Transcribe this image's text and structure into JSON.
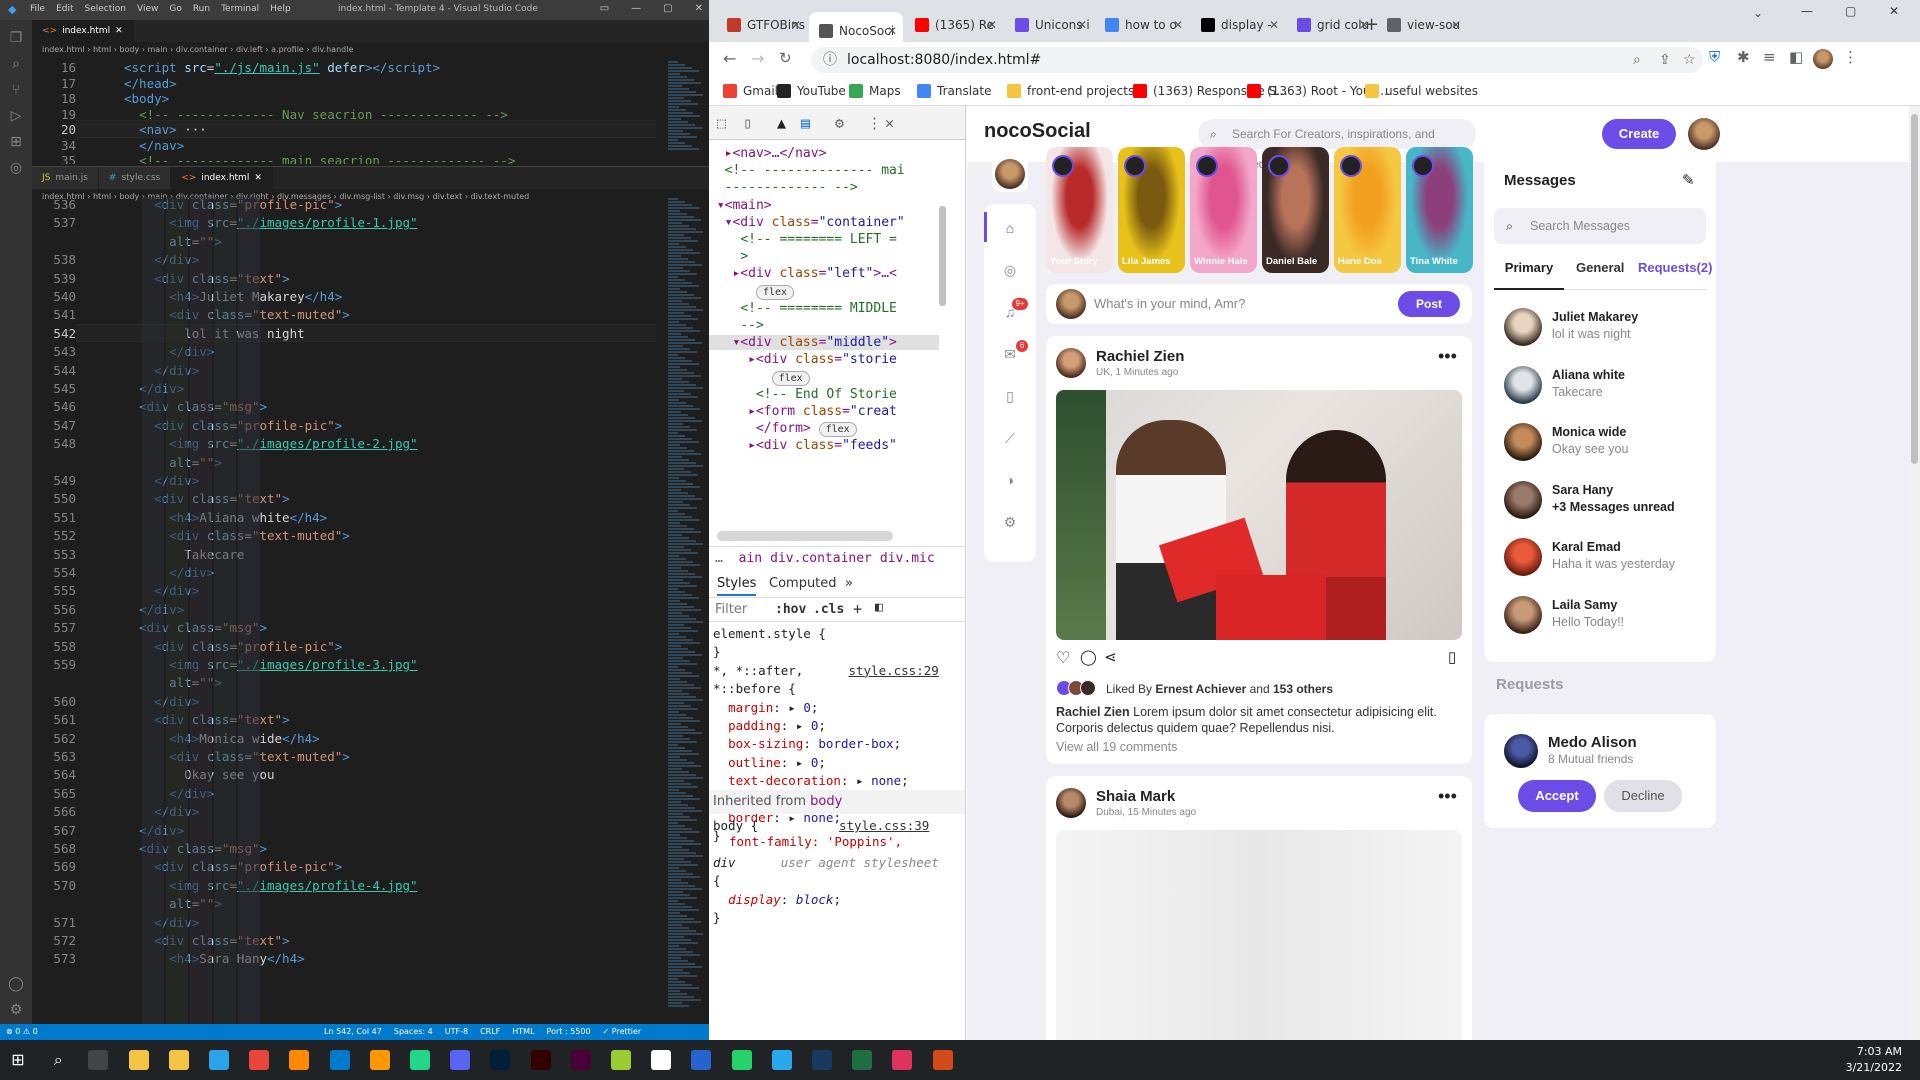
{
  "vscode": {
    "menu": [
      "File",
      "Edit",
      "Selection",
      "View",
      "Go",
      "Run",
      "Terminal",
      "Help"
    ],
    "window_title": "index.html - Template 4 - Visual Studio Code",
    "top_tab": "index.html",
    "top_crumbs": "index.html › html › body › main › div.container › div.left › a.profile › div.handle",
    "top_lines": [
      {
        "n": "16",
        "html": "<span class='t-tag'>&lt;script</span> <span class='t-attr'>src</span>=<span class='t-lnk'>\"./js/main.js\"</span> <span class='t-attr'>defer</span><span class='t-tag'>&gt;&lt;/script&gt;</span>"
      },
      {
        "n": "17",
        "html": "<span class='t-tag'>&lt;/head&gt;</span>"
      },
      {
        "n": "18",
        "html": "<span class='t-tag'>&lt;body&gt;</span>"
      },
      {
        "n": "19",
        "html": "  <span class='t-com'>&lt;!-- ------------- Nav seacrion ------------- --&gt;</span>"
      },
      {
        "n": "20",
        "html": "  <span class='t-tag'>&lt;nav&gt;</span> ···"
      },
      {
        "n": "34",
        "html": "  <span class='t-tag'>&lt;/nav&gt;</span>"
      },
      {
        "n": "35",
        "html": "  <span class='t-com'>&lt;!-- ------------- main seacrion ------------- --&gt;</span>"
      }
    ],
    "bottom_tabs": [
      "main.js",
      "style.css",
      "index.html"
    ],
    "bottom_crumbs": "index.html › html › body › main › div.container › div.right › div.messages › div.msg-list › div.msg › div.text › div.text-muted",
    "bottom_lines": [
      {
        "n": "536",
        "html": "    <span class='t-tag'>&lt;div</span> <span class='t-attr'>class</span>=<span class='t-str'>\"profile-pic\"</span><span class='t-tag'>&gt;</span>"
      },
      {
        "n": "537",
        "html": "      <span class='t-tag'>&lt;img</span> <span class='t-attr'>src</span>=<span class='t-lnk'>\"./images/profile-1.jpg\"</span>"
      },
      {
        "n": "",
        "html": "      <span class='t-attr'>alt</span>=<span class='t-str'>\"\"</span><span class='t-tag'>&gt;</span>"
      },
      {
        "n": "538",
        "html": "    <span class='t-tag'>&lt;/div&gt;</span>"
      },
      {
        "n": "539",
        "html": "    <span class='t-tag'>&lt;div</span> <span class='t-attr'>class</span>=<span class='t-str'>\"text\"</span><span class='t-tag'>&gt;</span>"
      },
      {
        "n": "540",
        "html": "      <span class='t-tag'>&lt;h4&gt;</span>Juliet Makarey<span class='t-tag'>&lt;/h4&gt;</span>"
      },
      {
        "n": "541",
        "html": "      <span class='t-tag'>&lt;div</span> <span class='t-attr'>class</span>=<span class='t-str'>\"text-muted\"</span><span class='t-tag'>&gt;</span>"
      },
      {
        "n": "542",
        "html": "        lol it was night"
      },
      {
        "n": "543",
        "html": "      <span class='t-tag'>&lt;/div&gt;</span>"
      },
      {
        "n": "544",
        "html": "    <span class='t-tag'>&lt;/div&gt;</span>"
      },
      {
        "n": "545",
        "html": "  <span class='t-tag'>&lt;/div&gt;</span>"
      },
      {
        "n": "546",
        "html": "  <span class='t-tag'>&lt;div</span> <span class='t-attr'>class</span>=<span class='t-str'>\"msg\"</span><span class='t-tag'>&gt;</span>"
      },
      {
        "n": "547",
        "html": "    <span class='t-tag'>&lt;div</span> <span class='t-attr'>class</span>=<span class='t-str'>\"profile-pic\"</span><span class='t-tag'>&gt;</span>"
      },
      {
        "n": "548",
        "html": "      <span class='t-tag'>&lt;img</span> <span class='t-attr'>src</span>=<span class='t-lnk'>\"./images/profile-2.jpg\"</span>"
      },
      {
        "n": "",
        "html": "      <span class='t-attr'>alt</span>=<span class='t-str'>\"\"</span><span class='t-tag'>&gt;</span>"
      },
      {
        "n": "549",
        "html": "    <span class='t-tag'>&lt;/div&gt;</span>"
      },
      {
        "n": "550",
        "html": "    <span class='t-tag'>&lt;div</span> <span class='t-attr'>class</span>=<span class='t-str'>\"text\"</span><span class='t-tag'>&gt;</span>"
      },
      {
        "n": "551",
        "html": "      <span class='t-tag'>&lt;h4&gt;</span>Aliana white<span class='t-tag'>&lt;/h4&gt;</span>"
      },
      {
        "n": "552",
        "html": "      <span class='t-tag'>&lt;div</span> <span class='t-attr'>class</span>=<span class='t-str'>\"text-muted\"</span><span class='t-tag'>&gt;</span>"
      },
      {
        "n": "553",
        "html": "        Takecare"
      },
      {
        "n": "554",
        "html": "      <span class='t-tag'>&lt;/div&gt;</span>"
      },
      {
        "n": "555",
        "html": "    <span class='t-tag'>&lt;/div&gt;</span>"
      },
      {
        "n": "556",
        "html": "  <span class='t-tag'>&lt;/div&gt;</span>"
      },
      {
        "n": "557",
        "html": "  <span class='t-tag'>&lt;div</span> <span class='t-attr'>class</span>=<span class='t-str'>\"msg\"</span><span class='t-tag'>&gt;</span>"
      },
      {
        "n": "558",
        "html": "    <span class='t-tag'>&lt;div</span> <span class='t-attr'>class</span>=<span class='t-str'>\"profile-pic\"</span><span class='t-tag'>&gt;</span>"
      },
      {
        "n": "559",
        "html": "      <span class='t-tag'>&lt;img</span> <span class='t-attr'>src</span>=<span class='t-lnk'>\"./images/profile-3.jpg\"</span>"
      },
      {
        "n": "",
        "html": "      <span class='t-attr'>alt</span>=<span class='t-str'>\"\"</span><span class='t-tag'>&gt;</span>"
      },
      {
        "n": "560",
        "html": "    <span class='t-tag'>&lt;/div&gt;</span>"
      },
      {
        "n": "561",
        "html": "    <span class='t-tag'>&lt;div</span> <span class='t-attr'>class</span>=<span class='t-str'>\"text\"</span><span class='t-tag'>&gt;</span>"
      },
      {
        "n": "562",
        "html": "      <span class='t-tag'>&lt;h4&gt;</span>Monica wide<span class='t-tag'>&lt;/h4&gt;</span>"
      },
      {
        "n": "563",
        "html": "      <span class='t-tag'>&lt;div</span> <span class='t-attr'>class</span>=<span class='t-str'>\"text-muted\"</span><span class='t-tag'>&gt;</span>"
      },
      {
        "n": "564",
        "html": "        Okay see you"
      },
      {
        "n": "565",
        "html": "      <span class='t-tag'>&lt;/div&gt;</span>"
      },
      {
        "n": "566",
        "html": "    <span class='t-tag'>&lt;/div&gt;</span>"
      },
      {
        "n": "567",
        "html": "  <span class='t-tag'>&lt;/div&gt;</span>"
      },
      {
        "n": "568",
        "html": "  <span class='t-tag'>&lt;div</span> <span class='t-attr'>class</span>=<span class='t-str'>\"msg\"</span><span class='t-tag'>&gt;</span>"
      },
      {
        "n": "569",
        "html": "    <span class='t-tag'>&lt;div</span> <span class='t-attr'>class</span>=<span class='t-str'>\"profile-pic\"</span><span class='t-tag'>&gt;</span>"
      },
      {
        "n": "570",
        "html": "      <span class='t-tag'>&lt;img</span> <span class='t-attr'>src</span>=<span class='t-lnk'>\"./images/profile-4.jpg\"</span>"
      },
      {
        "n": "",
        "html": "      <span class='t-attr'>alt</span>=<span class='t-str'>\"\"</span><span class='t-tag'>&gt;</span>"
      },
      {
        "n": "571",
        "html": "    <span class='t-tag'>&lt;/div&gt;</span>"
      },
      {
        "n": "572",
        "html": "    <span class='t-tag'>&lt;div</span> <span class='t-attr'>class</span>=<span class='t-str'>\"text\"</span><span class='t-tag'>&gt;</span>"
      },
      {
        "n": "573",
        "html": "      <span class='t-tag'>&lt;h4&gt;</span>Sara Hany<span class='t-tag'>&lt;/h4&gt;</span>"
      }
    ],
    "status_left": "⊗ 0  ⚠ 0",
    "status_items": [
      "Ln 542, Col 47",
      "Spaces: 4",
      "UTF-8",
      "CRLF",
      "HTML",
      "Port : 5500",
      "✓ Prettier"
    ]
  },
  "chrome": {
    "tabs": [
      {
        "label": "GTFOBins",
        "color": "#c0392b"
      },
      {
        "label": "NocoSoci",
        "color": "#555"
      },
      {
        "label": "(1365) Re",
        "color": "#ff0000"
      },
      {
        "label": "Unicons i",
        "color": "#6b4ce6"
      },
      {
        "label": "how to o",
        "color": "#4285f4"
      },
      {
        "label": "display -",
        "color": "#000"
      },
      {
        "label": "grid colu",
        "color": "#6b4ce6"
      },
      {
        "label": "view-sou",
        "color": "#5f6368"
      }
    ],
    "url": "localhost:8080/index.html#",
    "bookmarks": [
      {
        "label": "Gmail",
        "color": "#ea4335"
      },
      {
        "label": "YouTube",
        "color": "#222"
      },
      {
        "label": "Maps",
        "color": "#34a853"
      },
      {
        "label": "Translate",
        "color": "#4285f4"
      },
      {
        "label": "front-end projects",
        "color": "#f4c542"
      },
      {
        "label": "(1363) Responsive S...",
        "color": "#ff0000"
      },
      {
        "label": "(1363) Root - YouT...",
        "color": "#ff0000"
      },
      {
        "label": "useful websites",
        "color": "#f4c542"
      }
    ]
  },
  "devtools": {
    "elements": [
      {
        "html": "  ▸&lt;nav&gt;…&lt;/nav&gt;"
      },
      {
        "html": "  <span class='c'>&lt;!-- -------------- mai</span>"
      },
      {
        "html": "  <span class='c'>------------- --&gt;</span>"
      },
      {
        "html": " ▾&lt;main&gt;"
      },
      {
        "html": "  ▾&lt;div <span class='a'>class</span>=<span class='v'>\"container\"</span>"
      },
      {
        "html": "    <span class='c'>&lt;!-- ======== LEFT =</span>"
      },
      {
        "html": "    <span class='c'>&gt;</span>"
      },
      {
        "html": "   ▸&lt;div <span class='a'>class</span>=<span class='v'>\"left\"</span>&gt;…&lt;"
      },
      {
        "html": "      <span class='flexb'>flex</span>"
      },
      {
        "html": "    <span class='c'>&lt;!-- ======== MIDDLE</span>"
      },
      {
        "html": "    <span class='c'>--&gt;</span>"
      },
      {
        "html": "   ▾&lt;div <span class='a'>class</span>=<span class='v'>\"middle\"</span>&gt;"
      },
      {
        "html": "     ▸&lt;div <span class='a'>class</span>=<span class='v'>\"storie</span>"
      },
      {
        "html": "        <span class='flexb'>flex</span>"
      },
      {
        "html": "      <span class='c'>&lt;!-- End Of Storie</span>"
      },
      {
        "html": "     ▸&lt;form <span class='a'>class</span>=<span class='v'>\"creat</span>"
      },
      {
        "html": "      &lt;/form&gt; <span class='flexb'>flex</span>"
      },
      {
        "html": "     ▸&lt;div <span class='a'>class</span>=<span class='v'>\"feeds\"</span>"
      }
    ],
    "crumbs": [
      "ain",
      "div.container",
      "div.mic"
    ],
    "tabs": [
      "Styles",
      "Computed"
    ],
    "filter_placeholder": "Filter",
    "hov": ":hov",
    "cls": ".cls",
    "css": [
      {
        "html": "element.style {"
      },
      {
        "html": "}"
      },
      {
        "html": "*, *::after,      <span class='f'>style.css:29</span>"
      },
      {
        "html": "*::before {"
      },
      {
        "html": "  <span class='p'>margin</span>: ▸ <span class='s'>0</span>;"
      },
      {
        "html": "  <span class='p'>padding</span>: ▸ <span class='s'>0</span>;"
      },
      {
        "html": "  <span class='p'>box-sizing</span>: <span class='s'>border-box</span>;"
      },
      {
        "html": "  <span class='p'>outline</span>: ▸ <span class='s'>0</span>;"
      },
      {
        "html": "  <span class='p'>text-decoration</span>: ▸ <span class='s'>none</span>;"
      },
      {
        "html": "  <span class='p'>list-style</span>: ▸ <span class='s'>none</span>;"
      },
      {
        "html": "  <span class='p'>border</span>: ▸ <span class='s'>none</span>;"
      },
      {
        "html": "}"
      },
      {
        "html": "<i>div</i>      <i style='color:#888'>user agent stylesheet</i>"
      },
      {
        "html": "{"
      },
      {
        "html": "  <i class='p'>display</i>: <i class='s'>block</i>;"
      },
      {
        "html": "}"
      }
    ],
    "inherited_label": "Inherited from",
    "inherited_el": "body",
    "body_rule": "body {",
    "body_file": "style.css:39",
    "body_font": "font-family: 'Poppins',"
  },
  "page": {
    "logo": "nocoSocial",
    "search_placeholder": "Search For Creators, inspirations, and projects",
    "create": "Create",
    "stories": [
      {
        "name": "Your Story",
        "c1": "#f4e6e6",
        "c2": "#b92b2b"
      },
      {
        "name": "Lila James",
        "c1": "#e8c21a",
        "c2": "#7a5a10"
      },
      {
        "name": "Winnie Hale",
        "c1": "#f3a7c8",
        "c2": "#e0558f"
      },
      {
        "name": "Daniel Bale",
        "c1": "#3a2a26",
        "c2": "#b8735b"
      },
      {
        "name": "Hane Doe",
        "c1": "#f5c842",
        "c2": "#f2a020"
      },
      {
        "name": "Tina White",
        "c1": "#47b6c7",
        "c2": "#8c3f7b"
      }
    ],
    "create_post_placeholder": "What's in your mind, Amr?",
    "post_button": "Post",
    "feed1": {
      "name": "Rachiel Zien",
      "meta": "UK, 1 Minutes ago",
      "liked_prefix": "Liked By ",
      "liked_name": "Ernest Achiever",
      "liked_and": " and ",
      "liked_count": "153 others",
      "caption_name": "Rachiel Zien",
      "caption": " Lorem ipsum dolor sit amet consectetur adipisicing elit. Corporis delectus quidem quae? Repellendus nisi.",
      "comments": "View all 19 comments"
    },
    "feed2": {
      "name": "Shaia Mark",
      "meta": "Dubai, 15 Minutes ago"
    },
    "messages": {
      "title": "Messages",
      "search_placeholder": "Search Messages",
      "tabs": [
        "Primary",
        "General",
        "Requests(2)"
      ],
      "list": [
        {
          "name": "Juliet Makarey",
          "text": "lol it was night",
          "bold": false
        },
        {
          "name": "Aliana white",
          "text": "Takecare",
          "bold": false
        },
        {
          "name": "Monica wide",
          "text": "Okay see you",
          "bold": false
        },
        {
          "name": "Sara Hany",
          "text": "+3 Messages unread",
          "bold": true
        },
        {
          "name": "Karal Emad",
          "text": "Haha it was yesterday",
          "bold": false
        },
        {
          "name": "Laila Samy",
          "text": "Hello Today!!",
          "bold": false
        }
      ]
    },
    "requests": {
      "title": "Requests",
      "name": "Medo Alison",
      "mutual": "8 Mutual friends",
      "accept": "Accept",
      "decline": "Decline"
    },
    "notif_badge": "9+",
    "msg_badge": "6"
  },
  "taskbar": {
    "time": "7:03 AM",
    "date": "3/21/2022"
  },
  "colors": {
    "accent": "#6b4ce6",
    "vscode_status": "#007acc"
  }
}
